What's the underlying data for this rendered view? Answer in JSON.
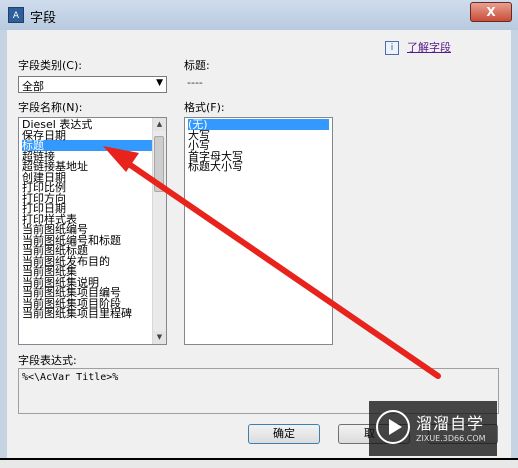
{
  "window": {
    "title": "字段",
    "app_icon": "autocad-icon",
    "close_label": "X"
  },
  "help": {
    "icon_glyph": "i",
    "link_text": "了解字段"
  },
  "category": {
    "label": "字段类别(C):",
    "value": "全部"
  },
  "names": {
    "label": "字段名称(N):",
    "selected_index": 2,
    "items": [
      "Diesel 表达式",
      "保存日期",
      "标题",
      "超链接",
      "超链接基地址",
      "创建日期",
      "打印比例",
      "打印方向",
      "打印日期",
      "打印样式表",
      "当前图纸编号",
      "当前图纸编号和标题",
      "当前图纸标题",
      "当前图纸发布目的",
      "当前图纸集",
      "当前图纸集说明",
      "当前图纸集项目编号",
      "当前图纸集项目阶段",
      "当前图纸集项目里程碑"
    ]
  },
  "title_field": {
    "label": "标题:",
    "value": "----"
  },
  "format": {
    "label": "格式(F):",
    "selected_index": 0,
    "items": [
      "(无)",
      "大写",
      "小写",
      "首字母大写",
      "标题大小写"
    ]
  },
  "expression": {
    "label": "字段表达式:",
    "value": "%<\\AcVar Title>%"
  },
  "buttons": {
    "ok": "确定",
    "cancel": "取"
  },
  "annotation": {
    "arrow_color": "#e8231b"
  },
  "watermark": {
    "brand": "溜溜自学",
    "url": "ZIXUE.3D66.COM"
  }
}
